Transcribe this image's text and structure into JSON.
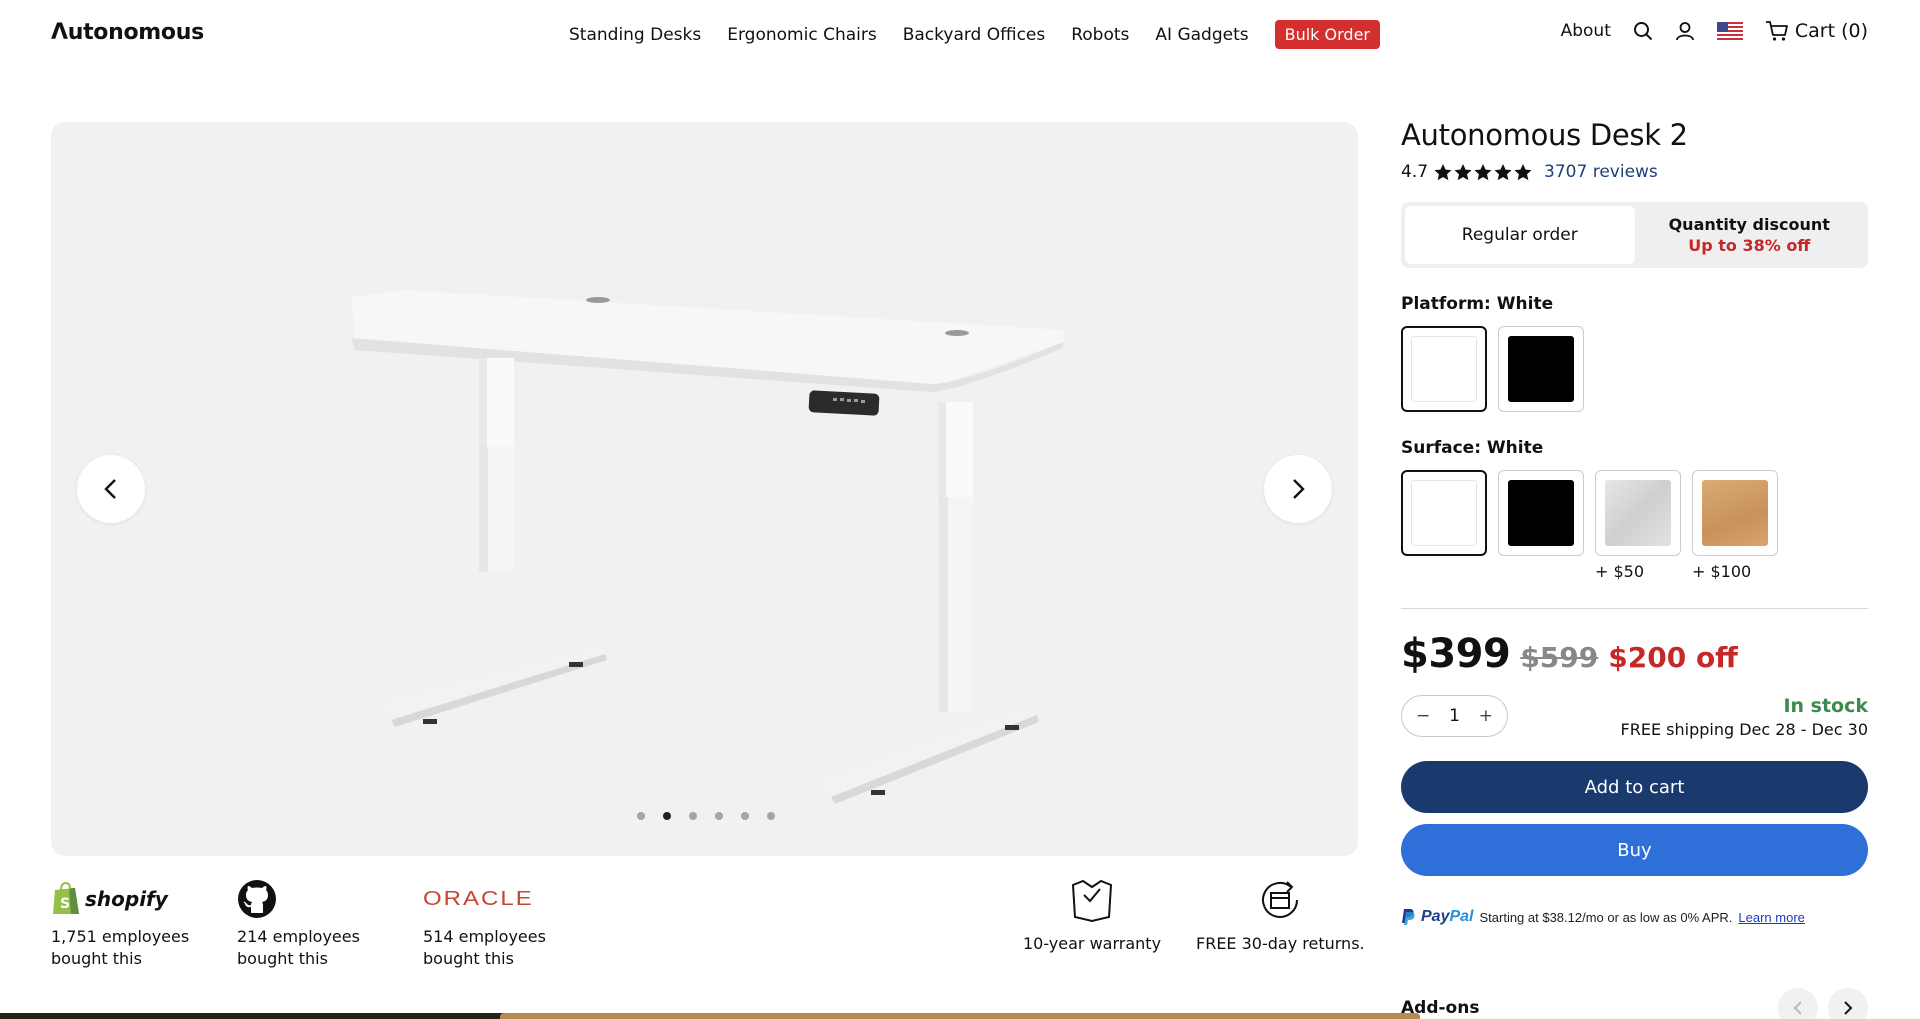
{
  "header": {
    "logo": "Λutonomous",
    "nav": [
      "Standing Desks",
      "Ergonomic Chairs",
      "Backyard Offices",
      "Robots",
      "AI Gadgets"
    ],
    "bulk_order": "Bulk Order",
    "about": "About",
    "cart_label": "Cart (0)"
  },
  "gallery": {
    "dots_count": 6,
    "active_dot": 2
  },
  "social_proof": [
    {
      "brand": "shopify",
      "brand_text": "shopify",
      "line1": "1,751 employees",
      "line2": "bought this"
    },
    {
      "brand": "github",
      "brand_text": "",
      "line1": "214 employees",
      "line2": "bought this"
    },
    {
      "brand": "oracle",
      "brand_text": "ORACLE",
      "line1": "514 employees",
      "line2": "bought this"
    }
  ],
  "features": {
    "warranty": "10-year warranty",
    "returns": "FREE 30-day returns."
  },
  "product": {
    "title": "Autonomous Desk 2",
    "rating": "4.7",
    "rating_value": 4.7,
    "reviews": "3707 reviews",
    "order_regular": "Regular order",
    "order_quantity": "Quantity discount",
    "order_quantity_sub": "Up to 38% off",
    "platform_label": "Platform: White",
    "surface_label": "Surface: White",
    "platform_colors": [
      "#ffffff",
      "#000000"
    ],
    "surface_colors": [
      "#ffffff",
      "#000000",
      "#dcdcdc",
      "#d1a06a"
    ],
    "surface_prices": [
      "",
      "",
      "+ $50",
      "+ $100"
    ],
    "price_now": "$399",
    "price_old": "$599",
    "price_off": "$200 off",
    "qty_minus": "−",
    "qty": "1",
    "qty_plus": "+",
    "stock": "In stock",
    "shipping": "FREE shipping Dec 28 - Dec 30",
    "add_to_cart": "Add to cart",
    "buy": "Buy",
    "paypal_logo_pay": "Pay",
    "paypal_logo_pal": "Pal",
    "paypal_text": "Starting at $38.12/mo or as low as 0% APR.",
    "paypal_link": "Learn more",
    "addons": "Add-ons"
  },
  "colors": {
    "accent_red": "#d32f2f",
    "primary_navy": "#1a3a6e",
    "buy_blue": "#2f6fd9",
    "in_stock_green": "#3b8a4e"
  }
}
